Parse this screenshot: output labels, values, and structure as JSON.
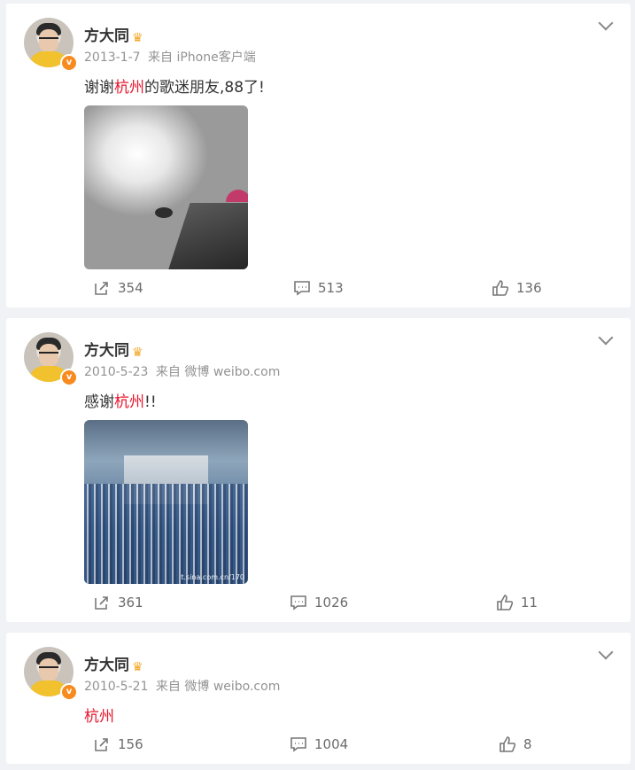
{
  "posts": [
    {
      "author": "方大同",
      "date": "2013-1-7",
      "source": "来自 iPhone客户端",
      "text_before": "谢谢",
      "text_link": "杭州",
      "text_after": "的歌迷朋友,88了!",
      "has_image": true,
      "repost_count": "354",
      "comment_count": "513",
      "like_count": "136"
    },
    {
      "author": "方大同",
      "date": "2010-5-23",
      "source": "来自 微博 weibo.com",
      "text_before": "感谢",
      "text_link": "杭州",
      "text_after": "!!",
      "has_image": true,
      "image_watermark": "t.sina.com.cn/170",
      "repost_count": "361",
      "comment_count": "1026",
      "like_count": "11"
    },
    {
      "author": "方大同",
      "date": "2010-5-21",
      "source": "来自 微博 weibo.com",
      "text_before": "",
      "text_link": "杭州",
      "text_after": "",
      "has_image": false,
      "repost_count": "156",
      "comment_count": "1004",
      "like_count": "8"
    }
  ],
  "badge_letter": "v",
  "colors": {
    "highlight": "#e6162d",
    "badge": "#f78b1f",
    "background": "#f1f2f5"
  },
  "icons": [
    "chevron-down-icon",
    "repost-icon",
    "comment-icon",
    "like-icon",
    "crown-icon",
    "verified-icon"
  ]
}
